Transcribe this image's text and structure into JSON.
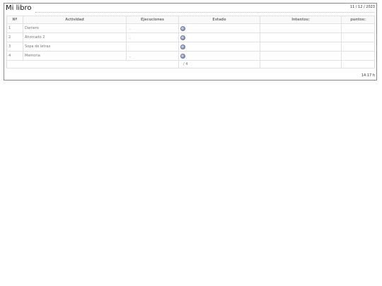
{
  "report": {
    "title": "Mi libro",
    "date": "11 / 12 / 2023",
    "time": "14:17 h"
  },
  "table": {
    "headers": [
      "Nº",
      "Actividad",
      "Ejecuciones",
      "Estado",
      "Intentos:",
      "puntos:"
    ],
    "rows": [
      {
        "num": "1",
        "activity": "Damero",
        "executions": "-",
        "state_icon": "status-dot-icon",
        "attempts": "",
        "points": ""
      },
      {
        "num": "2",
        "activity": "Ahorcado 2",
        "executions": "-",
        "state_icon": "status-dot-icon",
        "attempts": "",
        "points": ""
      },
      {
        "num": "3",
        "activity": "Sopa de letras",
        "executions": "",
        "state_icon": "status-dot-icon",
        "attempts": "",
        "points": ""
      },
      {
        "num": "4",
        "activity": "Memoria",
        "executions": "-",
        "state_icon": "status-dot-icon",
        "attempts": "",
        "points": ""
      }
    ],
    "total": "/ 4"
  },
  "colors": {
    "border": "#8a8a8a",
    "grid": "#e1e1e1",
    "text": "#777777",
    "icon": "#8e9bbd"
  }
}
